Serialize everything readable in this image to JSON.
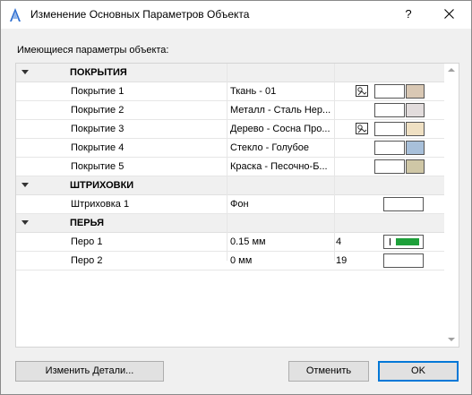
{
  "window": {
    "title": "Изменение Основных Параметров Объекта",
    "help_label": "?",
    "close_label": "✕"
  },
  "section_label": "Имеющиеся параметры объекта:",
  "groups": {
    "coverings": {
      "title": "ПОКРЫТИЯ",
      "rows": [
        {
          "name": "Покрытие 1",
          "value": "Ткань - 01",
          "color": "#d9c8b4",
          "pick_icon": true
        },
        {
          "name": "Покрытие 2",
          "value": "Металл - Сталь Нер...",
          "color": "#e2dcdc",
          "pick_icon": false
        },
        {
          "name": "Покрытие 3",
          "value": "Дерево - Сосна Про...",
          "color": "#efe0c3",
          "pick_icon": true
        },
        {
          "name": "Покрытие 4",
          "value": "Стекло - Голубое",
          "color": "#a8c0da",
          "pick_icon": false
        },
        {
          "name": "Покрытие 5",
          "value": "Краска - Песочно-Б...",
          "color": "#cfc7a6",
          "pick_icon": false
        }
      ]
    },
    "hatches": {
      "title": "ШТРИХОВКИ",
      "rows": [
        {
          "name": "Штриховка 1",
          "value": "Фон"
        }
      ]
    },
    "pens": {
      "title": "ПЕРЬЯ",
      "rows": [
        {
          "name": "Перо 1",
          "value": "0.15 мм",
          "number": "4",
          "color": "#1ea03a"
        },
        {
          "name": "Перо 2",
          "value": "0 мм",
          "number": "19"
        }
      ]
    }
  },
  "buttons": {
    "details": "Изменить Детали...",
    "cancel": "Отменить",
    "ok": "OK"
  }
}
